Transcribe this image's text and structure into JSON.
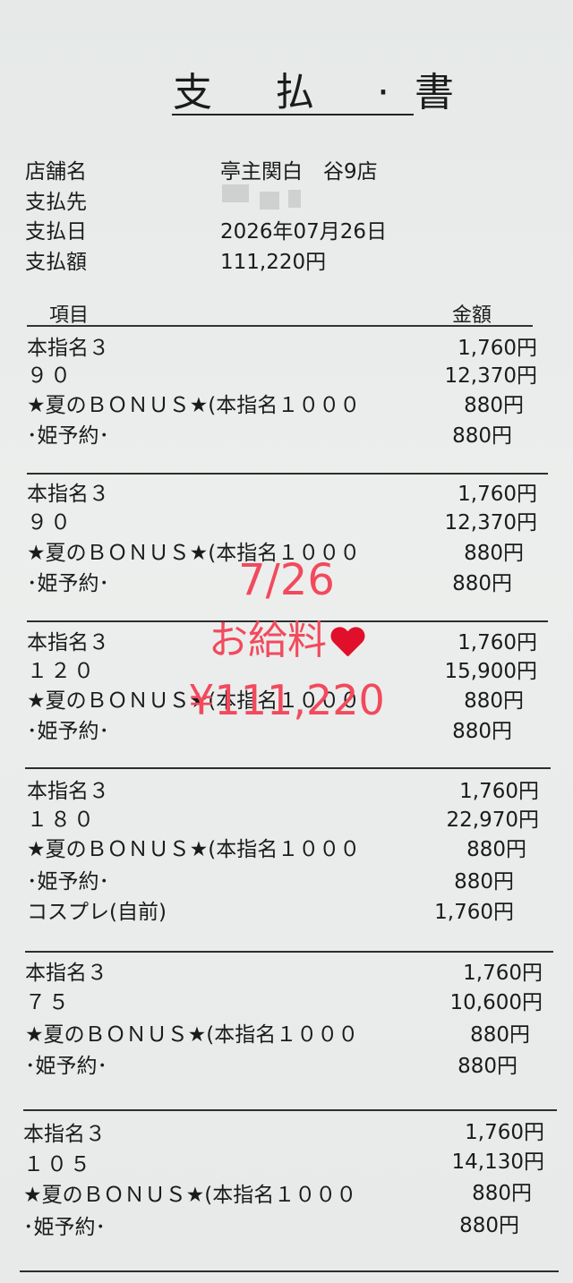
{
  "header": {
    "title": "支 払 ·書",
    "fields": [
      {
        "label": "店舗名",
        "value": "亭主関白　谷9店"
      },
      {
        "label": "支払先",
        "value": ""
      },
      {
        "label": "支払日",
        "value": "2026年07月26日"
      },
      {
        "label": "支払額",
        "value": "111,220円"
      }
    ]
  },
  "table": {
    "col_item": "項目",
    "col_amount": "金額"
  },
  "groups": [
    {
      "items": [
        {
          "name": "本指名３",
          "amount": "1,760円"
        },
        {
          "name": "９０",
          "amount": "12,370円"
        },
        {
          "name": "★夏のＢＯＮＵＳ★(本指名１０００",
          "amount": "880円"
        },
        {
          "name": "･姫予約･",
          "amount": "880円"
        }
      ]
    },
    {
      "items": [
        {
          "name": "本指名３",
          "amount": "1,760円"
        },
        {
          "name": "９０",
          "amount": "12,370円"
        },
        {
          "name": "★夏のＢＯＮＵＳ★(本指名１０００",
          "amount": "880円"
        },
        {
          "name": "･姫予約･",
          "amount": "880円"
        }
      ]
    },
    {
      "items": [
        {
          "name": "本指名３",
          "amount": "1,760円"
        },
        {
          "name": "１２０",
          "amount": "15,900円"
        },
        {
          "name": "★夏のＢＯＮＵＳ★(本指名１０００",
          "amount": "880円"
        },
        {
          "name": "･姫予約･",
          "amount": "880円"
        }
      ]
    },
    {
      "items": [
        {
          "name": "本指名３",
          "amount": "1,760円"
        },
        {
          "name": "１８０",
          "amount": "22,970円"
        },
        {
          "name": "★夏のＢＯＮＵＳ★(本指名１０００",
          "amount": "880円"
        },
        {
          "name": "･姫予約･",
          "amount": "880円"
        },
        {
          "name": "コスプレ(自前)",
          "amount": "1,760円"
        }
      ]
    },
    {
      "items": [
        {
          "name": "本指名３",
          "amount": "1,760円"
        },
        {
          "name": "７５",
          "amount": "10,600円"
        },
        {
          "name": "★夏のＢＯＮＵＳ★(本指名１０００",
          "amount": "880円"
        },
        {
          "name": "･姫予約･",
          "amount": "880円"
        }
      ]
    },
    {
      "items": [
        {
          "name": "本指名３",
          "amount": "1,760円"
        },
        {
          "name": "１０５",
          "amount": "14,130円"
        },
        {
          "name": "★夏のＢＯＮＵＳ★(本指名１０００",
          "amount": "880円"
        },
        {
          "name": "･姫予約･",
          "amount": "880円"
        }
      ]
    }
  ],
  "overlay": {
    "date": "7/26",
    "label": "お給料",
    "amount": "¥111,220",
    "heart_icon": "red-heart-icon",
    "color": "#f24a5d"
  }
}
